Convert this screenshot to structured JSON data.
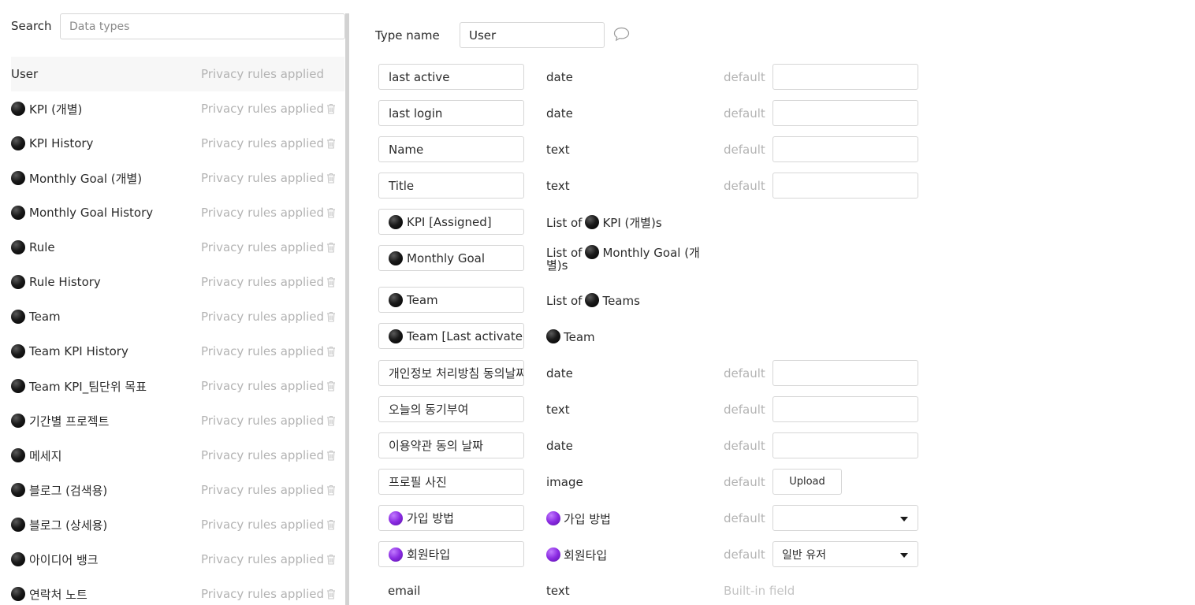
{
  "sidebar": {
    "search_label": "Search",
    "search_placeholder": "Data types",
    "types": [
      {
        "name": "User",
        "privacy": "Privacy rules applied",
        "icon": "",
        "selected": true,
        "deletable": false
      },
      {
        "name": "KPI (개별)",
        "privacy": "Privacy rules applied",
        "icon": "black-circle",
        "deletable": true
      },
      {
        "name": "KPI History",
        "privacy": "Privacy rules applied",
        "icon": "black-circle",
        "deletable": true
      },
      {
        "name": "Monthly Goal (개별)",
        "privacy": "Privacy rules applied",
        "icon": "black-circle",
        "deletable": true
      },
      {
        "name": "Monthly Goal History",
        "privacy": "Privacy rules applied",
        "icon": "black-circle",
        "deletable": true
      },
      {
        "name": "Rule",
        "privacy": "Privacy rules applied",
        "icon": "black-circle",
        "deletable": true
      },
      {
        "name": "Rule History",
        "privacy": "Privacy rules applied",
        "icon": "black-circle",
        "deletable": true
      },
      {
        "name": "Team",
        "privacy": "Privacy rules applied",
        "icon": "black-circle",
        "deletable": true
      },
      {
        "name": "Team KPI History",
        "privacy": "Privacy rules applied",
        "icon": "black-circle",
        "deletable": true
      },
      {
        "name": "Team KPI_팀단위 목표",
        "privacy": "Privacy rules applied",
        "icon": "black-circle",
        "deletable": true
      },
      {
        "name": "기간별 프로젝트",
        "privacy": "Privacy rules applied",
        "icon": "black-circle",
        "deletable": true
      },
      {
        "name": "메세지",
        "privacy": "Privacy rules applied",
        "icon": "black-circle",
        "deletable": true
      },
      {
        "name": "블로그 (검색용)",
        "privacy": "Privacy rules applied",
        "icon": "black-circle",
        "deletable": true
      },
      {
        "name": "블로그 (상세용)",
        "privacy": "Privacy rules applied",
        "icon": "black-circle",
        "deletable": true
      },
      {
        "name": "아이디어 뱅크",
        "privacy": "Privacy rules applied",
        "icon": "black-circle",
        "deletable": true
      },
      {
        "name": "연락처 노트",
        "privacy": "Privacy rules applied",
        "icon": "black-circle",
        "deletable": true
      }
    ]
  },
  "editor": {
    "type_name_label": "Type name",
    "type_name_value": "User",
    "fields": [
      {
        "name": "last active",
        "name_icon": "",
        "type_parts": [
          {
            "text": "date"
          }
        ],
        "default_label": "default",
        "default_kind": "input",
        "default_value": ""
      },
      {
        "name": "last login",
        "name_icon": "",
        "type_parts": [
          {
            "text": "date"
          }
        ],
        "default_label": "default",
        "default_kind": "input",
        "default_value": ""
      },
      {
        "name": "Name",
        "name_icon": "",
        "type_parts": [
          {
            "text": "text"
          }
        ],
        "default_label": "default",
        "default_kind": "input",
        "default_value": ""
      },
      {
        "name": "Title",
        "name_icon": "",
        "type_parts": [
          {
            "text": "text"
          }
        ],
        "default_label": "default",
        "default_kind": "input",
        "default_value": ""
      },
      {
        "name": "KPI [Assigned]",
        "name_icon": "black-circle",
        "type_parts": [
          {
            "text": "List of"
          },
          {
            "icon": "black-circle"
          },
          {
            "text": "KPI (개별)s"
          }
        ],
        "default_kind": "none"
      },
      {
        "name": "Monthly Goal",
        "name_icon": "black-circle",
        "type_parts": [
          {
            "text": "List of"
          },
          {
            "icon": "black-circle"
          },
          {
            "text": "Monthly Goal (개별)s"
          }
        ],
        "default_kind": "none"
      },
      {
        "name": "Team",
        "name_icon": "black-circle",
        "type_parts": [
          {
            "text": "List of"
          },
          {
            "icon": "black-circle"
          },
          {
            "text": "Teams"
          }
        ],
        "default_kind": "none"
      },
      {
        "name": "Team [Last activated",
        "name_icon": "black-circle",
        "type_parts": [
          {
            "icon": "black-circle"
          },
          {
            "text": "Team"
          }
        ],
        "default_kind": "none"
      },
      {
        "name": "개인정보 처리방침 동의날짜",
        "name_icon": "",
        "type_parts": [
          {
            "text": "date"
          }
        ],
        "default_label": "default",
        "default_kind": "input",
        "default_value": ""
      },
      {
        "name": "오늘의 동기부여",
        "name_icon": "",
        "type_parts": [
          {
            "text": "text"
          }
        ],
        "default_label": "default",
        "default_kind": "input",
        "default_value": ""
      },
      {
        "name": "이용약관 동의 날짜",
        "name_icon": "",
        "type_parts": [
          {
            "text": "date"
          }
        ],
        "default_label": "default",
        "default_kind": "input",
        "default_value": ""
      },
      {
        "name": "프로필 사진",
        "name_icon": "",
        "type_parts": [
          {
            "text": "image"
          }
        ],
        "default_label": "default",
        "default_kind": "upload",
        "default_value": "Upload"
      },
      {
        "name": "가입 방법",
        "name_icon": "purple-circle",
        "type_parts": [
          {
            "icon": "purple-circle"
          },
          {
            "text": "가입 방법"
          }
        ],
        "default_label": "default",
        "default_kind": "select",
        "default_value": ""
      },
      {
        "name": "회원타입",
        "name_icon": "purple-circle",
        "type_parts": [
          {
            "icon": "purple-circle"
          },
          {
            "text": "회원타입"
          }
        ],
        "default_label": "default",
        "default_kind": "select",
        "default_value": "일반 유저"
      },
      {
        "name": "email",
        "name_icon": "",
        "plain": true,
        "type_parts": [
          {
            "text": "text"
          }
        ],
        "default_kind": "builtin",
        "builtin_label": "Built-in field"
      }
    ]
  },
  "colors": {
    "text": "#2b2b2b",
    "muted": "#b3b3b3",
    "border": "#d6d6d6",
    "selected_row": "#f7f7f7",
    "option_set_icon": "#8a2be2",
    "thing_icon": "#000000"
  }
}
